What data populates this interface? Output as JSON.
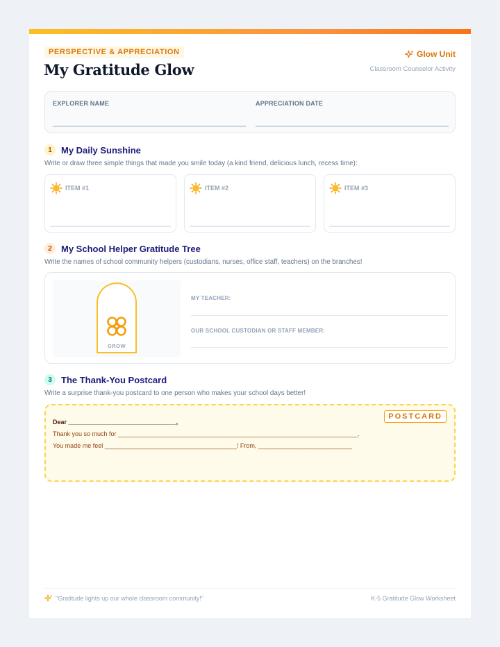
{
  "header": {
    "tag": "PERSPECTIVE & APPRECIATION",
    "title": "My Gratitude Glow",
    "unit": "Glow Unit",
    "unit_icon": "sparkle-icon",
    "subtitle": "Classroom Counselor Activity"
  },
  "fields": {
    "name_label": "EXPLORER NAME",
    "date_label": "APPRECIATION DATE"
  },
  "section1": {
    "number": "1",
    "title": "My Daily Sunshine",
    "description": "Write or draw three simple things that made you smile today (a kind friend, delicious lunch, recess time):",
    "item_icon": "sun-icon",
    "items": [
      {
        "label": "ITEM #1"
      },
      {
        "label": "ITEM #2"
      },
      {
        "label": "ITEM #3"
      }
    ]
  },
  "section2": {
    "number": "2",
    "title": "My School Helper Gratitude Tree",
    "description": "Write the names of school community helpers (custodians, nurses, office staff, teachers) on the branches!",
    "tree_label": "GROW",
    "helpers": [
      {
        "label": "MY TEACHER:"
      },
      {
        "label": "OUR SCHOOL CUSTODIAN OR STAFF MEMBER:"
      }
    ]
  },
  "section3": {
    "number": "3",
    "title": "The Thank-You Postcard",
    "description": "Write a surprise thank-you postcard to one person who makes your school days better!",
    "stamp": "POSTCARD",
    "lines": {
      "dear": "Dear _______________________________,",
      "thanks": "Thank you so much for _____________________________________________________________________.",
      "feel": "You made me feel ______________________________________! From, ___________________________"
    }
  },
  "footer": {
    "quote": "\"Gratitude lights up our whole classroom community!\"",
    "right": "K-5 Gratitude Glow Worksheet"
  },
  "colors": {
    "accent": "#f59e0b",
    "heading": "#1e1b7b",
    "badge1": "#fef3c7",
    "badge2": "#ffedd5",
    "badge3": "#ccfbf1"
  }
}
